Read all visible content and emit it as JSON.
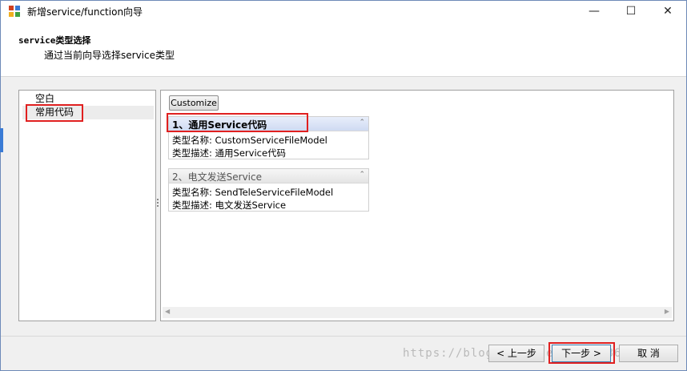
{
  "window": {
    "title": "新增service/function向导",
    "minimize_glyph": "—",
    "maximize_glyph": "☐",
    "close_glyph": "✕"
  },
  "header": {
    "title": "service类型选择",
    "subtitle": "通过当前向导选择service类型"
  },
  "left_panel": {
    "items": [
      {
        "label": "空白",
        "selected": false
      },
      {
        "label": "常用代码",
        "selected": true
      }
    ]
  },
  "right_panel": {
    "customize_label": "Customize",
    "cards": [
      {
        "title": "1、通用Service代码",
        "type_name": "类型名称: CustomServiceFileModel",
        "type_desc": "类型描述: 通用Service代码",
        "active": true
      },
      {
        "title": "2、电文发送Service",
        "type_name": "类型名称: SendTeleServiceFileModel",
        "type_desc": "类型描述: 电文发送Service",
        "active": false
      }
    ],
    "collapse_glyph": "⌃"
  },
  "footer": {
    "prev_label": "< 上一步",
    "next_label": "下一步 >",
    "cancel_label": "取 消"
  },
  "watermark": "https://blog.csdn.net/qq_37363761",
  "icons": {
    "app": "app-icon",
    "colors": [
      "#d04020",
      "#3a7bd5",
      "#f0b020",
      "#40a040"
    ]
  },
  "accent": {
    "highlight_box": "#e02020"
  }
}
